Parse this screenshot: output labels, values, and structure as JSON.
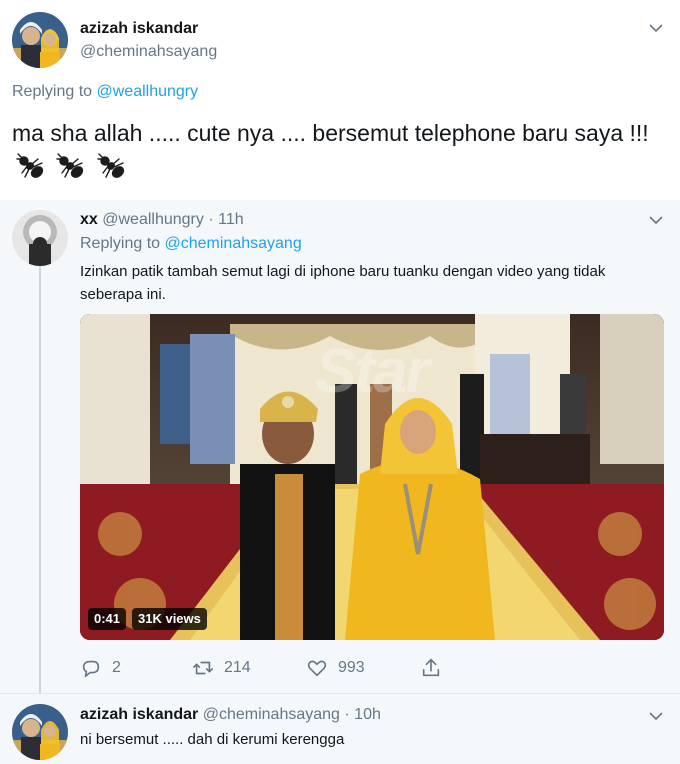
{
  "main_tweet": {
    "name": "azizah iskandar",
    "handle": "@cheminahsayang",
    "replying_label": "Replying to",
    "replying_to": "@weallhungry",
    "text": "ma sha allah ..... cute nya .... bersemut telephone baru saya !!!",
    "emoji_icons": [
      "ant-icon",
      "ant-icon",
      "ant-icon"
    ]
  },
  "reply_tweet": {
    "name": "xx",
    "handle": "@weallhungry",
    "time": "· 11h",
    "replying_label": "Replying to",
    "replying_to": "@cheminahsayang",
    "text": "Izinkan patik tambah semut lagi di iphone baru tuanku dengan video yang tidak seberapa ini.",
    "video": {
      "duration": "0:41",
      "views": "31K views",
      "watermark": "Star"
    },
    "actions": {
      "replies": "2",
      "retweets": "214",
      "likes": "993"
    }
  },
  "third_tweet": {
    "name": "azizah iskandar",
    "handle": "@cheminahsayang",
    "time": "· 10h",
    "text": "ni bersemut ..... dah di kerumi kerengga"
  },
  "colors": {
    "link": "#1da1f2",
    "muted": "#657786",
    "text": "#14171a",
    "thread_bg": "#f5f8fa"
  }
}
